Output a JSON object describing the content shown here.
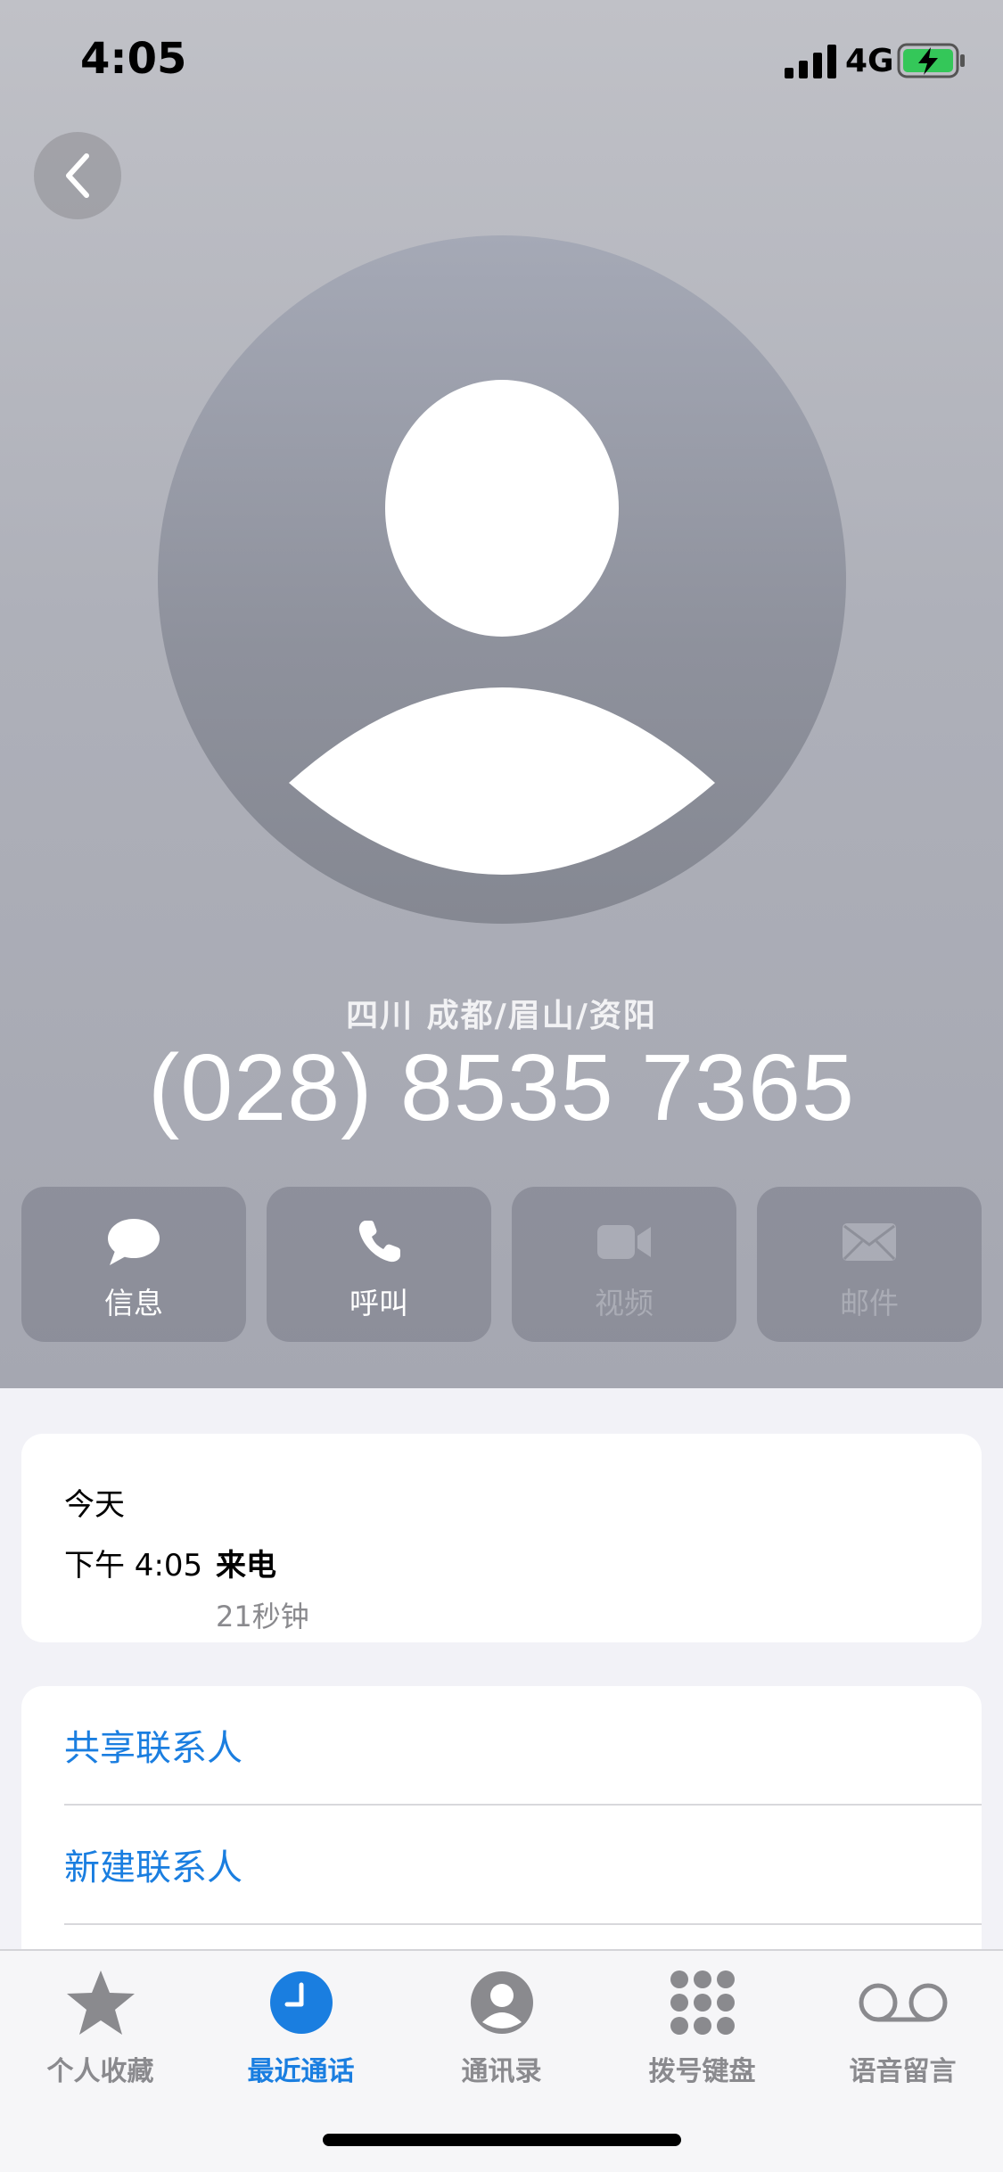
{
  "status_bar": {
    "time": "4:05",
    "network": "4G",
    "signal_icon": "signal-bars-icon",
    "battery_icon": "battery-charging-icon"
  },
  "header": {
    "back_icon": "chevron-left-icon",
    "avatar_icon": "person-silhouette-icon",
    "location": "四川 成都/眉山/资阳",
    "phone_number": "(028) 8535 7365"
  },
  "actions": [
    {
      "label": "信息",
      "icon": "message-bubble-icon",
      "enabled": true
    },
    {
      "label": "呼叫",
      "icon": "phone-icon",
      "enabled": true
    },
    {
      "label": "视频",
      "icon": "video-camera-icon",
      "enabled": false
    },
    {
      "label": "邮件",
      "icon": "envelope-icon",
      "enabled": false
    }
  ],
  "call_history": {
    "day": "今天",
    "time": "下午 4:05",
    "type": "来电",
    "duration": "21秒钟"
  },
  "contact_actions": [
    {
      "label": "共享联系人"
    },
    {
      "label": "新建联系人"
    }
  ],
  "tab_bar": {
    "tabs": [
      {
        "label": "个人收藏",
        "icon": "star-icon",
        "active": false
      },
      {
        "label": "最近通话",
        "icon": "clock-icon",
        "active": true
      },
      {
        "label": "通讯录",
        "icon": "person-circle-icon",
        "active": false
      },
      {
        "label": "拨号键盘",
        "icon": "keypad-icon",
        "active": false
      },
      {
        "label": "语音留言",
        "icon": "voicemail-icon",
        "active": false
      }
    ]
  },
  "colors": {
    "accent": "#1a7ee0",
    "inactive": "#8a8a8e",
    "background": "#f2f2f7"
  }
}
